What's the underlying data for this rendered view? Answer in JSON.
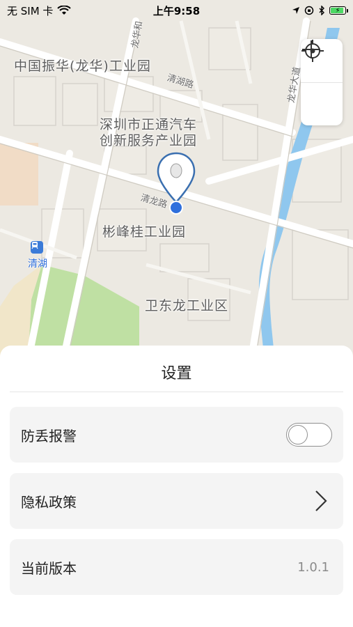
{
  "status_bar": {
    "carrier": "无 SIM 卡",
    "time": "上午9:58",
    "battery_color": "#4cd964"
  },
  "map": {
    "labels": {
      "park_zhenhua": "中国振华(龙华)工业园",
      "park_zhengtong_1": "深圳市正通汽车",
      "park_zhengtong_2": "创新服务产业园",
      "park_binfeng": "彬峰桂工业园",
      "park_weidong": "卫东龙工业区",
      "metro_station": "清湖"
    },
    "roads": {
      "qinghu_road": "清湖路",
      "qinglong_road": "清龙路",
      "longhua_ave": "龙华大道",
      "longhua_road_top": "龙华和"
    },
    "controls": {
      "zoom_in_icon": "plus-icon",
      "locate_icon": "crosshair-icon"
    },
    "accent_color": "#2f6fdc",
    "water_color": "#8fc7ee",
    "park_color": "#bfe0a3"
  },
  "settings": {
    "title": "设置",
    "anti_loss": {
      "label": "防丢报警",
      "enabled": false
    },
    "privacy": {
      "label": "隐私政策"
    },
    "version": {
      "label": "当前版本",
      "value": "1.0.1"
    }
  }
}
